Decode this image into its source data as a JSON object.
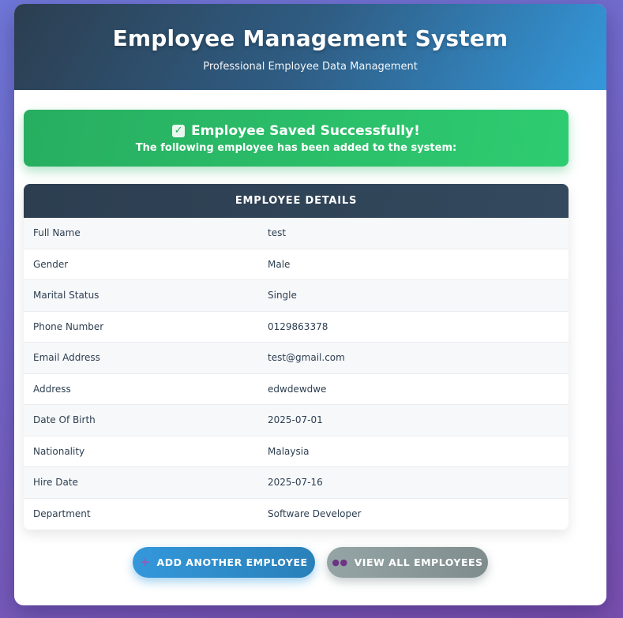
{
  "header": {
    "title": "Employee Management System",
    "subtitle": "Professional Employee Data Management"
  },
  "alert": {
    "icon": "check-icon",
    "title": "Employee Saved Successfully!",
    "message": "The following employee has been added to the system:",
    "color": "#2ecc71"
  },
  "details": {
    "heading": "EMPLOYEE DETAILS",
    "rows": [
      {
        "label": "Full Name",
        "value": "test"
      },
      {
        "label": "Gender",
        "value": "Male"
      },
      {
        "label": "Marital Status",
        "value": "Single"
      },
      {
        "label": "Phone Number",
        "value": "0129863378"
      },
      {
        "label": "Email Address",
        "value": "test@gmail.com"
      },
      {
        "label": "Address",
        "value": "edwdewdwe"
      },
      {
        "label": "Date Of Birth",
        "value": "2025-07-01"
      },
      {
        "label": "Nationality",
        "value": "Malaysia"
      },
      {
        "label": "Hire Date",
        "value": "2025-07-16"
      },
      {
        "label": "Department",
        "value": "Software Developer"
      }
    ]
  },
  "actions": {
    "add_label": "ADD ANOTHER EMPLOYEE",
    "add_icon": "plus-icon",
    "view_label": "VIEW ALL EMPLOYEES",
    "view_icon": "users-icon"
  },
  "colors": {
    "header_dark": "#2c3e50",
    "header_light": "#3498db",
    "primary_button": "#3498db",
    "secondary_button": "#95a5a6"
  }
}
